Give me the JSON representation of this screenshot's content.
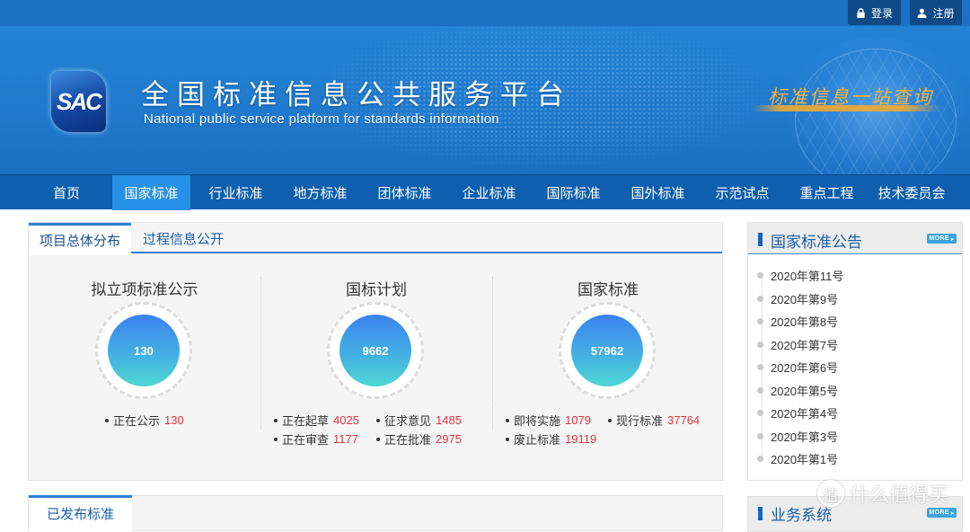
{
  "topbar": {
    "login_label": "登录",
    "register_label": "注册",
    "login_icon": "lock-icon",
    "register_icon": "user-icon"
  },
  "banner": {
    "logo_text": "SAC",
    "title": "全国标准信息公共服务平台",
    "subtitle": "National public service platform  for standards information",
    "slogan": "标准信息一站查询"
  },
  "nav": {
    "items": [
      {
        "label": "首页"
      },
      {
        "label": "国家标准",
        "active": true
      },
      {
        "label": "行业标准"
      },
      {
        "label": "地方标准"
      },
      {
        "label": "团体标准"
      },
      {
        "label": "企业标准"
      },
      {
        "label": "国际标准"
      },
      {
        "label": "国外标准"
      },
      {
        "label": "示范试点"
      },
      {
        "label": "重点工程"
      },
      {
        "label": "技术委员会"
      }
    ]
  },
  "main": {
    "tabs": [
      {
        "label": "项目总体分布",
        "active": true
      },
      {
        "label": "过程信息公开"
      }
    ],
    "columns": [
      {
        "title": "拟立项标准公示",
        "total": "130",
        "stats": [
          {
            "label": "正在公示",
            "value": "130"
          }
        ]
      },
      {
        "title": "国标计划",
        "total": "9662",
        "stats": [
          {
            "label": "正在起草",
            "value": "4025"
          },
          {
            "label": "征求意见",
            "value": "1485"
          },
          {
            "label": "正在审查",
            "value": "1177"
          },
          {
            "label": "正在批准",
            "value": "2975"
          }
        ]
      },
      {
        "title": "国家标准",
        "total": "57962",
        "stats": [
          {
            "label": "即将实施",
            "value": "1079"
          },
          {
            "label": "现行标准",
            "value": "37764"
          },
          {
            "label": "废止标准",
            "value": "19119"
          }
        ]
      }
    ],
    "published_tab": "已发布标准"
  },
  "sidebar": {
    "notices": {
      "title": "国家标准公告",
      "more_label": "MORE",
      "items": [
        "2020年第11号",
        "2020年第9号",
        "2020年第8号",
        "2020年第7号",
        "2020年第6号",
        "2020年第5号",
        "2020年第4号",
        "2020年第3号",
        "2020年第1号"
      ]
    },
    "business": {
      "title": "业务系统",
      "more_label": "MORE"
    }
  },
  "watermark": {
    "icon_text": "值",
    "text": "什么值得买"
  },
  "colors": {
    "brand_blue": "#1a72c4",
    "nav_blue": "#0e5fae",
    "nav_active": "#2691e6",
    "value_red": "#e0333a",
    "slogan_gold": "#f3b33d"
  }
}
